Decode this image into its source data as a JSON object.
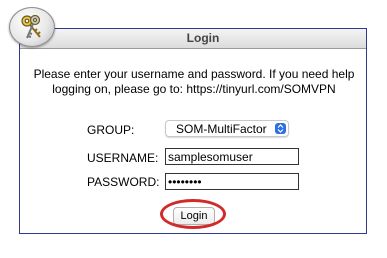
{
  "header": {
    "title": "Login",
    "logo_icon": "keys-icon"
  },
  "intro": {
    "text": "Please enter your username and password. If you need help logging on, please go to: https://tinyurl.com/SOMVPN"
  },
  "form": {
    "group_label": "GROUP:",
    "group_value": "SOM-MultiFactor",
    "username_label": "USERNAME:",
    "username_value": "samplesomuser",
    "password_label": "PASSWORD:",
    "password_value": "••••••••",
    "login_label": "Login"
  },
  "colors": {
    "border": "#2f3a8f",
    "highlight_ring": "#d12a2a",
    "select_accent": "#2d6fe3"
  }
}
